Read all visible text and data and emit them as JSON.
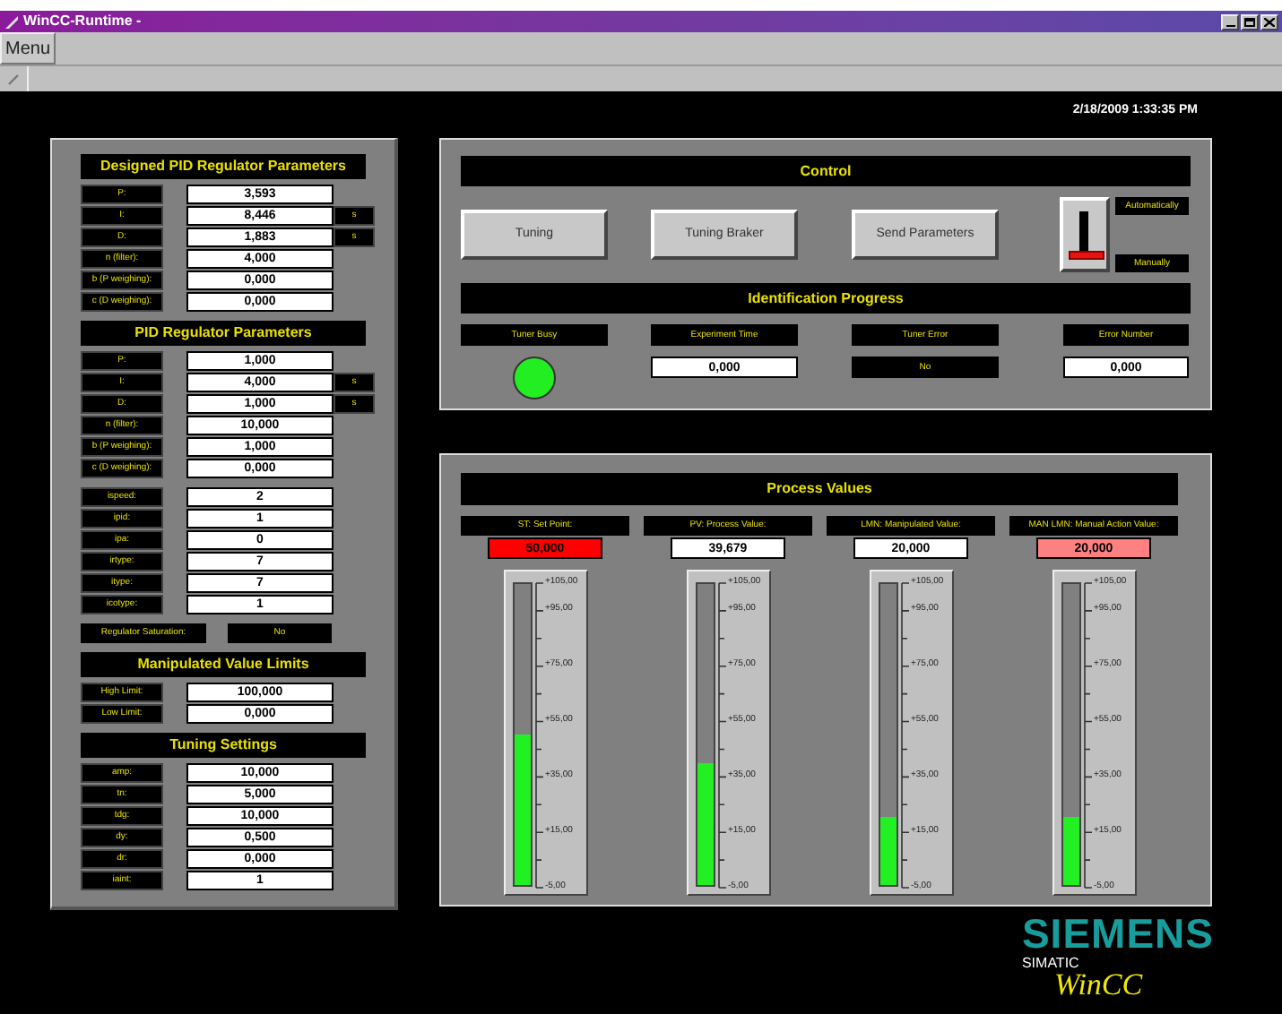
{
  "window": {
    "title": "WinCC-Runtime -"
  },
  "menu": {
    "label": "Menu"
  },
  "datetime": "2/18/2009 1:33:35 PM",
  "left_panel": {
    "sections": [
      {
        "title": "Designed PID Regulator Parameters",
        "rows": [
          {
            "label": "P:",
            "value": "3,593"
          },
          {
            "label": "I:",
            "value": "8,446",
            "unit": "s"
          },
          {
            "label": "D:",
            "value": "1,883",
            "unit": "s"
          },
          {
            "label": "n (filter):",
            "value": "4,000"
          },
          {
            "label": "b (P weighing):",
            "value": "0,000"
          },
          {
            "label": "c (D weighing):",
            "value": "0,000"
          }
        ]
      },
      {
        "title": "PID Regulator Parameters",
        "rows": [
          {
            "label": "P:",
            "value": "1,000"
          },
          {
            "label": "I:",
            "value": "4,000",
            "unit": "s"
          },
          {
            "label": "D:",
            "value": "1,000",
            "unit": "s"
          },
          {
            "label": "n (filter):",
            "value": "10,000"
          },
          {
            "label": "b (P weighing):",
            "value": "1,000"
          },
          {
            "label": "c (D weighing):",
            "value": "0,000"
          }
        ]
      },
      {
        "rows": [
          {
            "label": "ispeed:",
            "value": "2"
          },
          {
            "label": "ipid:",
            "value": "1"
          },
          {
            "label": "ipa:",
            "value": "0"
          },
          {
            "label": "irtype:",
            "value": "7"
          },
          {
            "label": "itype:",
            "value": "7"
          },
          {
            "label": "icotype:",
            "value": "1"
          }
        ]
      },
      {
        "status_label": "Regulator Saturation:",
        "status_value": "No"
      },
      {
        "title": "Manipulated Value Limits",
        "rows": [
          {
            "label": "High Limit:",
            "value": "100,000"
          },
          {
            "label": "Low Limit:",
            "value": "0,000"
          }
        ]
      },
      {
        "title": "Tuning Settings",
        "rows": [
          {
            "label": "amp:",
            "value": "10,000"
          },
          {
            "label": "tn:",
            "value": "5,000"
          },
          {
            "label": "tdg:",
            "value": "10,000"
          },
          {
            "label": "dy:",
            "value": "0,500"
          },
          {
            "label": "dr:",
            "value": "0,000"
          },
          {
            "label": "iaint:",
            "value": "1"
          }
        ]
      }
    ]
  },
  "control": {
    "title": "Control",
    "buttons": [
      "Tuning",
      "Tuning Braker",
      "Send Parameters"
    ],
    "mode_switch": {
      "manual": true,
      "labels": [
        "Automatically",
        "Manually"
      ]
    }
  },
  "identification": {
    "title": "Identification Progress",
    "items": [
      {
        "kind": "led",
        "label": "Tuner Busy",
        "on": true
      },
      {
        "kind": "field",
        "label": "Experiment Time",
        "value": "0,000"
      },
      {
        "kind": "text",
        "label": "Tuner Error",
        "value": "No"
      },
      {
        "kind": "field",
        "label": "Error Number",
        "value": "0,000"
      }
    ]
  },
  "process_values": {
    "title": "Process Values",
    "gauges": [
      {
        "label": "ST: Set Point:",
        "value": "50,000",
        "color": "#ff0000",
        "level": 0.5,
        "ticks": [
          "+105,00",
          "+95,00",
          "+75,00",
          "+55,00",
          "+35,00",
          "+15,00",
          "-5,00"
        ]
      },
      {
        "label": "PV: Process Value:",
        "value": "39,679",
        "color": "#ffffff",
        "level": 0.406,
        "ticks": [
          "+105,00",
          "+95,00",
          "+75,00",
          "+55,00",
          "+35,00",
          "+15,00",
          "-5,00"
        ]
      },
      {
        "label": "LMN: Manipulated Value:",
        "value": "20,000",
        "color": "#ffffff",
        "level": 0.227,
        "ticks": [
          "+105,00",
          "+95,00",
          "+75,00",
          "+55,00",
          "+35,00",
          "+15,00",
          "-5,00"
        ]
      },
      {
        "label": "MAN LMN: Manual Action Value:",
        "value": "20,000",
        "color": "#ff8080",
        "level": 0.227,
        "ticks": [
          "+105,00",
          "+95,00",
          "+75,00",
          "+55,00",
          "+35,00",
          "+15,00",
          "-5,00"
        ]
      }
    ]
  },
  "logo": {
    "brand": "SIEMENS",
    "line": "SIMATIC",
    "product": "WinCC"
  }
}
